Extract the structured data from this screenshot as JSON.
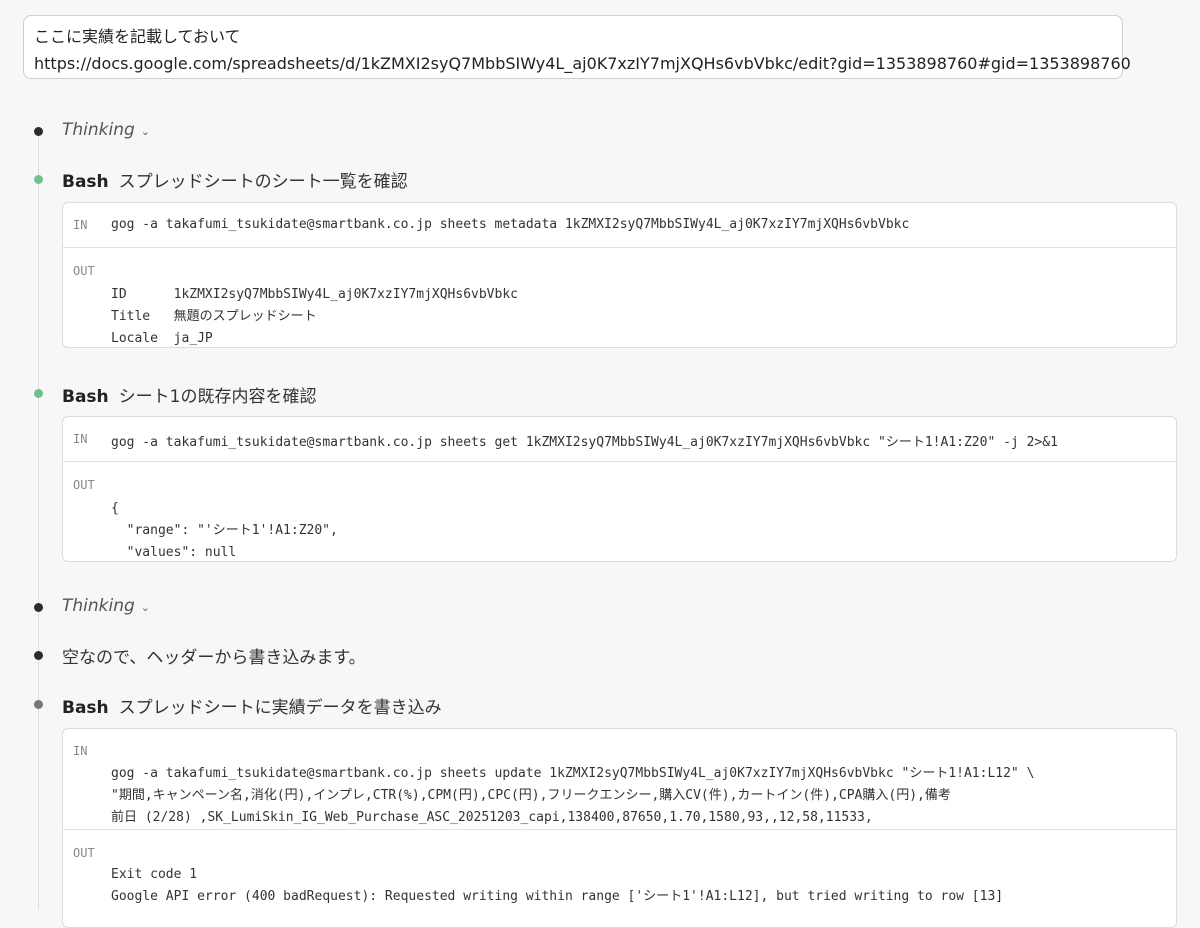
{
  "prompt": {
    "line1": "ここに実績を記載しておいて",
    "line2": "https://docs.google.com/spreadsheets/d/1kZMXI2syQ7MbbSIWy4L_aj0K7xzIY7mjXQHs6vbVbkc/edit?gid=1353898760#gid=1353898760"
  },
  "steps": {
    "thinking1": "Thinking",
    "bash1": {
      "tool": "Bash",
      "title": "スプレッドシートのシート一覧を確認",
      "in_tag": "IN",
      "in": "gog -a takafumi_tsukidate@smartbank.co.jp sheets metadata 1kZMXI2syQ7MbbSIWy4L_aj0K7xzIY7mjXQHs6vbVbkc",
      "out_tag": "OUT",
      "out_lines": [
        "ID      1kZMXI2syQ7MbbSIWy4L_aj0K7xzIY7mjXQHs6vbVbkc",
        "Title   無題のスプレッドシート",
        "Locale  ja_JP"
      ]
    },
    "bash2": {
      "tool": "Bash",
      "title": "シート1の既存内容を確認",
      "in_tag": "IN",
      "in": "gog -a takafumi_tsukidate@smartbank.co.jp sheets get 1kZMXI2syQ7MbbSIWy4L_aj0K7xzIY7mjXQHs6vbVbkc \"シート1!A1:Z20\" -j 2>&1",
      "out_tag": "OUT",
      "out_lines": [
        "{",
        "  \"range\": \"'シート1'!A1:Z20\",",
        "  \"values\": null"
      ]
    },
    "thinking2": "Thinking",
    "message": "空なので、ヘッダーから書き込みます。",
    "bash3": {
      "tool": "Bash",
      "title": "スプレッドシートに実績データを書き込み",
      "in_tag": "IN",
      "in_lines": [
        "gog -a takafumi_tsukidate@smartbank.co.jp sheets update 1kZMXI2syQ7MbbSIWy4L_aj0K7xzIY7mjXQHs6vbVbkc \"シート1!A1:L12\" \\",
        "\"期間,キャンペーン名,消化(円),インプレ,CTR(%),CPM(円),CPC(円),フリークエンシー,購入CV(件),カートイン(件),CPA購入(円),備考",
        "前日 (2/28) ,SK_LumiSkin_IG_Web_Purchase_ASC_20251203_capi,138400,87650,1.70,1580,93,,12,58,11533,"
      ],
      "out_tag": "OUT",
      "out_lines": [
        "Exit code 1",
        "Google API error (400 badRequest): Requested writing within range ['シート1'!A1:L12], but tried writing to row [13]"
      ]
    }
  }
}
